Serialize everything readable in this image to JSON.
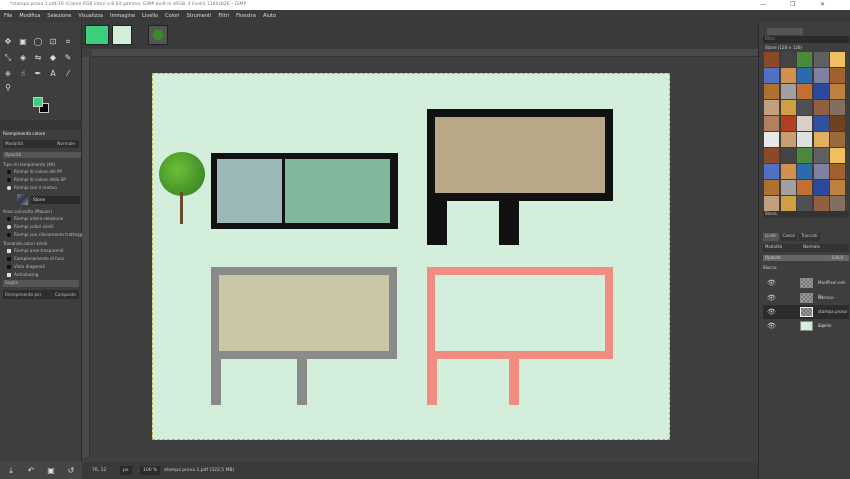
{
  "window": {
    "title": "*stampa prova 1.odt-10 (Colore RGB interi a 8 bit gamma, GIMP built-in sRGB, 4 livelli) 1160x826 – GIMP",
    "minimize": "—",
    "maximize": "❐",
    "close": "✕"
  },
  "menu": [
    "File",
    "Modifica",
    "Selezione",
    "Visualizza",
    "Immagine",
    "Livello",
    "Colori",
    "Strumenti",
    "Filtri",
    "Finestra",
    "Aiuto"
  ],
  "tool_options": {
    "title": "Riempimento colore",
    "mode_label": "Modalità",
    "mode_value": "Normale",
    "opacity_label": "Opacità",
    "fill_type_label": "Tipo di riempimento (Alt)",
    "fill_types": [
      "Riempi di colore del PP",
      "Riempi di colore dello SP",
      "Riempi con il motivo"
    ],
    "pattern_name": "Stone",
    "area_label": "Area coinvolta (Maiusc)",
    "areas": [
      "Riempi intera selezione",
      "Riempi colori simili",
      "Riempi con rilevamento tratteggio"
    ],
    "similar_label": "Trovando colori simili",
    "similar": [
      "Riempi aree trasparenti",
      "Campionamento di fuso",
      "Visto diagonali",
      "Antialiasing"
    ],
    "threshold_label": "Soglia",
    "fill_by_label": "Riempimento per",
    "fill_by_value": "Composto"
  },
  "colors": {
    "fg": "#3ccf7e",
    "bg": "#000000",
    "image_bg": "#d3efdc",
    "salmon": "#f08c80",
    "wall": "#111111",
    "gray_wall": "#8a8a8a"
  },
  "patterns": {
    "filter_placeholder": "Filtro",
    "header": "Stone (128 × 128)",
    "selected": "Stone,"
  },
  "layers": {
    "tabs": [
      "Livelli",
      "Canali",
      "Tracciati"
    ],
    "mode_label": "Modalità",
    "mode_value": "Normale",
    "opacity_label": "Opacità",
    "opacity_value": "100,0",
    "lock_label": "Blocco:",
    "items": [
      {
        "name": "ModPixel.net-Pn"
      },
      {
        "name": "woman-1272061"
      },
      {
        "name": "stampa prova 1.p"
      },
      {
        "name": "Livello"
      }
    ]
  },
  "status": {
    "coords": "76, 12",
    "unit": "px",
    "zoom": "100 %",
    "info": "stampa prova 1.pdf (322,5 MB)"
  }
}
